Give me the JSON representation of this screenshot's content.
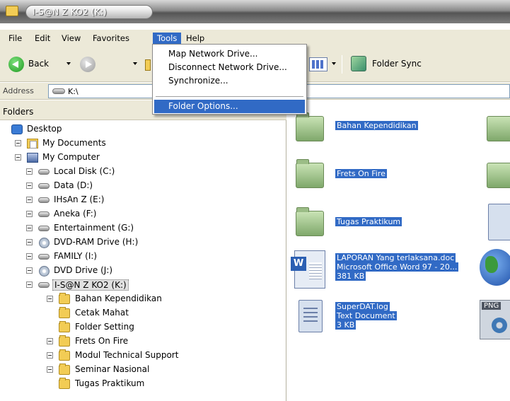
{
  "window": {
    "title": "I-S@N Z KO2 (K:)"
  },
  "menu": {
    "items": [
      "File",
      "Edit",
      "View",
      "Favorites",
      "Tools",
      "Help"
    ],
    "active": "Tools"
  },
  "tools_menu": {
    "items": [
      "Map Network Drive...",
      "Disconnect Network Drive...",
      "Synchronize...",
      "Folder Options..."
    ],
    "highlighted": "Folder Options..."
  },
  "toolbar": {
    "back_label": "Back",
    "folder_sync_label": "Folder Sync"
  },
  "address": {
    "label": "Address",
    "value": "K:\\"
  },
  "folders_pane": {
    "title": "Folders",
    "tree": [
      {
        "label": "Desktop",
        "icon": "desktop-icon"
      },
      {
        "label": "My Documents",
        "icon": "my-documents-icon"
      },
      {
        "label": "My Computer",
        "icon": "my-computer-icon"
      },
      {
        "label": "Local Disk (C:)",
        "icon": "drive-icon"
      },
      {
        "label": "Data (D:)",
        "icon": "drive-icon"
      },
      {
        "label": "IHsAn Z (E:)",
        "icon": "drive-icon"
      },
      {
        "label": "Aneka (F:)",
        "icon": "drive-icon"
      },
      {
        "label": "Entertainment (G:)",
        "icon": "drive-icon"
      },
      {
        "label": "DVD-RAM Drive (H:)",
        "icon": "dvd-icon"
      },
      {
        "label": "FAMILY (I:)",
        "icon": "drive-icon"
      },
      {
        "label": "DVD Drive (J:)",
        "icon": "dvd-icon"
      },
      {
        "label": "I-S@N Z KO2 (K:)",
        "icon": "drive-icon"
      },
      {
        "label": "Bahan Kependidikan",
        "icon": "folder-icon"
      },
      {
        "label": "Cetak Mahat",
        "icon": "folder-icon"
      },
      {
        "label": "Folder Setting",
        "icon": "folder-icon"
      },
      {
        "label": "Frets On Fire",
        "icon": "folder-icon"
      },
      {
        "label": "Modul Technical Support",
        "icon": "folder-icon"
      },
      {
        "label": "Seminar Nasional",
        "icon": "folder-icon"
      },
      {
        "label": "Tugas Praktikum",
        "icon": "folder-icon"
      }
    ],
    "selected": "I-S@N Z KO2 (K:)"
  },
  "files": [
    {
      "lines": [
        "Bahan Kependidikan"
      ],
      "icon": "folder-icon"
    },
    {
      "lines": [
        "Frets On Fire"
      ],
      "icon": "folder-icon"
    },
    {
      "lines": [
        "Tugas Praktikum"
      ],
      "icon": "folder-icon"
    },
    {
      "lines": [
        "LAPORAN Yang terlaksana.doc",
        "Microsoft Office Word 97 - 20...",
        "381 KB"
      ],
      "icon": "word-document-icon"
    },
    {
      "lines": [
        "SuperDAT.log",
        "Text Document",
        "3 KB"
      ],
      "icon": "text-document-icon"
    }
  ],
  "colors": {
    "selection": "#316ac5",
    "chrome": "#ece9d8"
  }
}
